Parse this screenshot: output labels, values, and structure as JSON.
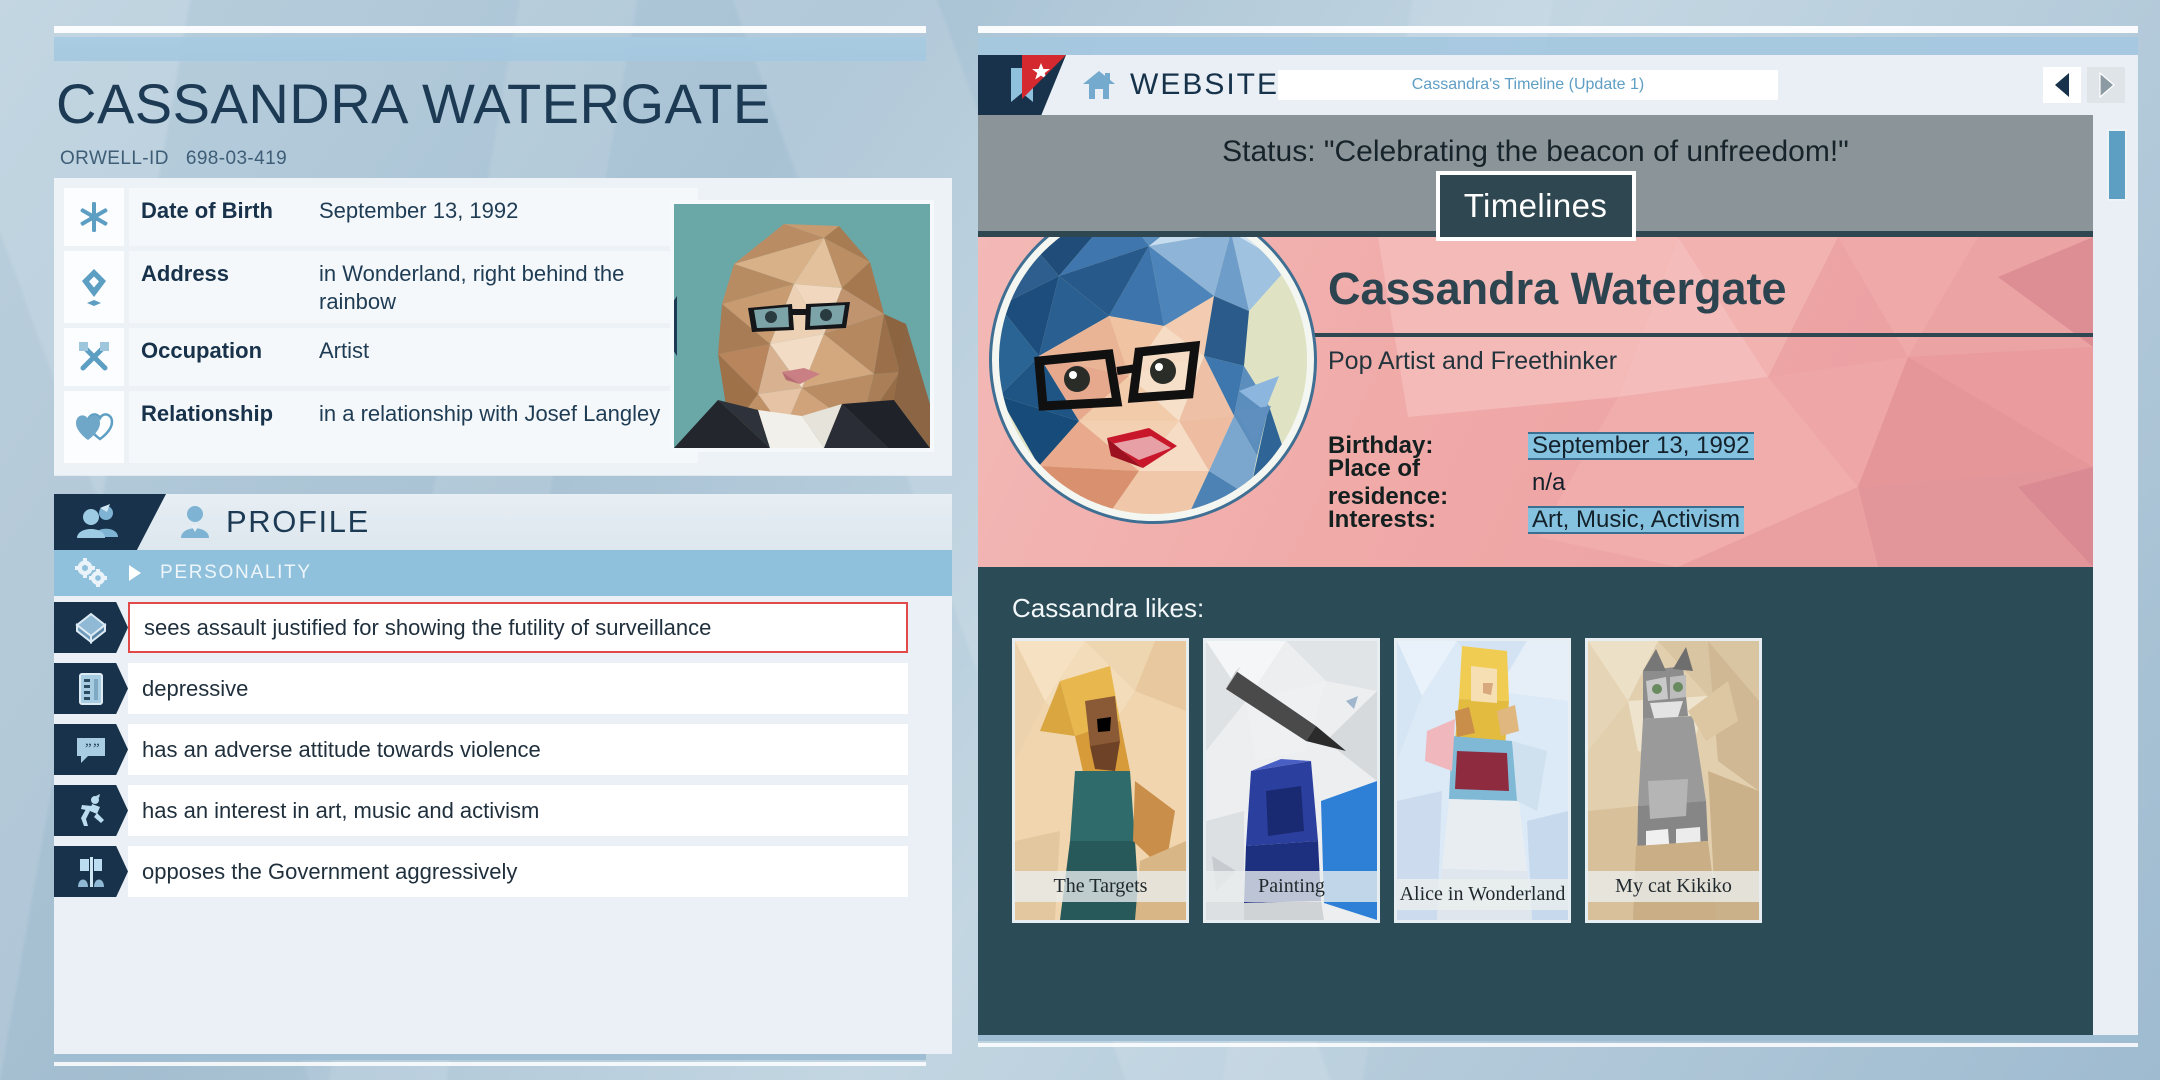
{
  "dossier": {
    "name": "CASSANDRA WATERGATE",
    "id_label": "ORWELL-ID",
    "id_value": "698-03-419",
    "photo_alt": "low-poly portrait of a woman with glasses and long brown hair on teal background",
    "info_rows": [
      {
        "icon": "asterisk-icon",
        "key": "Date of Birth",
        "value": "September 13, 1992"
      },
      {
        "icon": "location-pin-icon",
        "key": "Address",
        "value": "in Wonderland, right behind the rainbow"
      },
      {
        "icon": "tools-icon",
        "key": "Occupation",
        "value": "Artist"
      },
      {
        "icon": "hearts-icon",
        "key": "Relationship",
        "value": "in a relationship with Josef Langley"
      }
    ],
    "profile": {
      "tab_icon": "people-group-icon",
      "title_icon": "person-icon",
      "title": "PROFILE",
      "subsection": {
        "icon": "gears-icon",
        "arrow": "chevron-right-icon",
        "label": "PERSONALITY"
      },
      "traits": [
        {
          "icon": "datachunk-diamond-icon",
          "text": "sees assault justified for showing the futility of surveillance",
          "flagged": true
        },
        {
          "icon": "datachunk-card-icon",
          "text": "depressive",
          "flagged": false
        },
        {
          "icon": "quote-bubble-icon",
          "text": "has an adverse attitude towards violence",
          "flagged": false
        },
        {
          "icon": "running-person-icon",
          "text": "has an interest in art, music and activism",
          "flagged": false
        },
        {
          "icon": "protest-icon",
          "text": "opposes the Government aggressively",
          "flagged": false
        }
      ]
    }
  },
  "browser": {
    "bookmark_icon": "bookmark-icon",
    "flag_star_icon": "star-icon",
    "home_icon": "home-icon",
    "site_name": "WEBSITE",
    "url_text": "Cassandra's Timeline (Update 1)",
    "back_icon": "arrow-left-icon",
    "forward_icon": "arrow-right-icon",
    "page": {
      "status": "Status: \"Celebrating the beacon of unfreedom!\"",
      "section_title": "Timelines",
      "avatar_alt": "low-poly portrait of a woman with blue hair, glasses and red lipstick",
      "profile_name": "Cassandra Watergate",
      "bio": "Pop Artist and Freethinker",
      "facts": [
        {
          "key": "Birthday:",
          "value": "September 13, 1992",
          "highlighted": true
        },
        {
          "key": "Place of residence:",
          "value": "n/a",
          "highlighted": false
        },
        {
          "key": "Interests:",
          "value": "Art, Music, Activism",
          "highlighted": true
        }
      ],
      "likes_title": "Cassandra likes:",
      "likes": [
        {
          "caption": "The Targets",
          "alt": "low-poly musician with guitar on orange background"
        },
        {
          "caption": "Painting",
          "alt": "low-poly paint brush and blue paint can"
        },
        {
          "caption": "Alice in Wonderland",
          "alt": "low-poly blonde girl in blue dress"
        },
        {
          "caption": "My cat Kikiko",
          "alt": "low-poly grey tabby cat in a cardboard box"
        }
      ]
    }
  },
  "colors": {
    "dark_navy": "#17324a",
    "accent_blue": "#8fc0dc",
    "flag_red": "#e24a4a",
    "page_pink": "#f0aaa8",
    "page_teal": "#2b4b56",
    "highlight": "#84c2e0"
  }
}
